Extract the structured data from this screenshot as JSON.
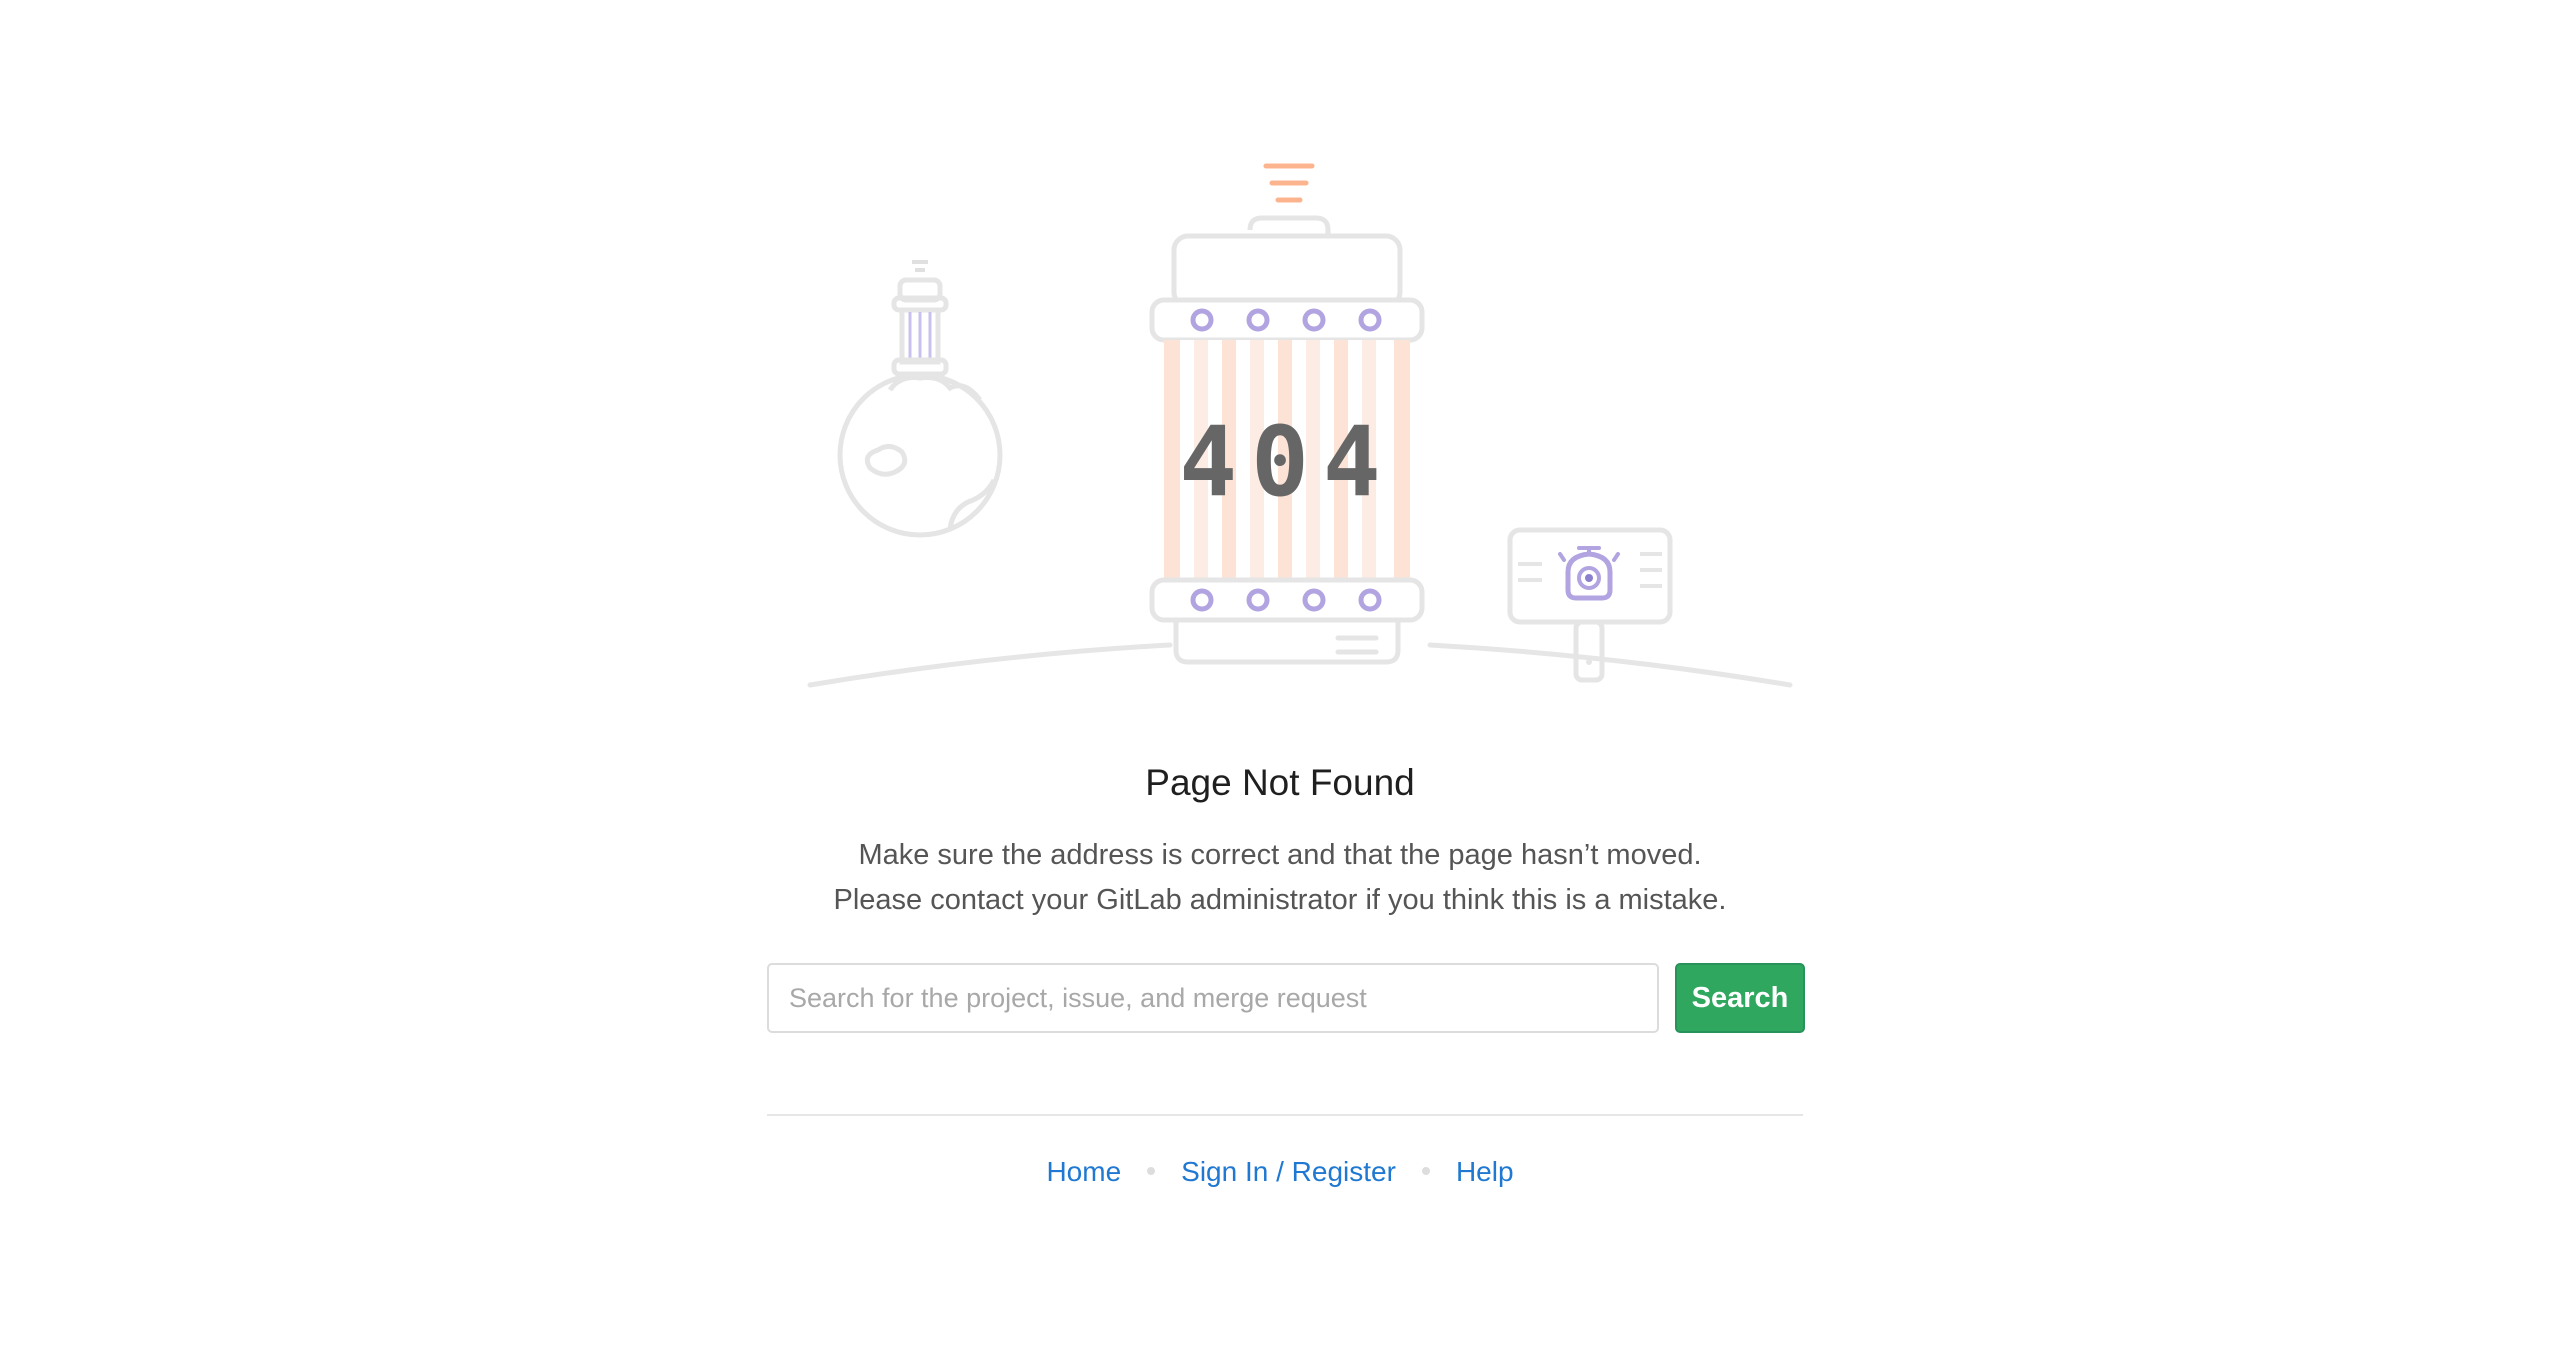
{
  "illustration": {
    "code": "404"
  },
  "title": "Page Not Found",
  "description": {
    "line1": "Make sure the address is correct and that the page hasn’t moved.",
    "line2": "Please contact your GitLab administrator if you think this is a mistake."
  },
  "search": {
    "placeholder": "Search for the project, issue, and merge request",
    "value": "",
    "button_label": "Search"
  },
  "footer": {
    "links": [
      {
        "label": "Home"
      },
      {
        "label": "Sign In / Register"
      },
      {
        "label": "Help"
      }
    ]
  },
  "colors": {
    "accent_green": "#2fa75f",
    "link_blue": "#1f78d1",
    "illustration_purple": "#b1a4e0",
    "illustration_orange": "#fc9867",
    "illustration_gray": "#e5e5e5"
  }
}
